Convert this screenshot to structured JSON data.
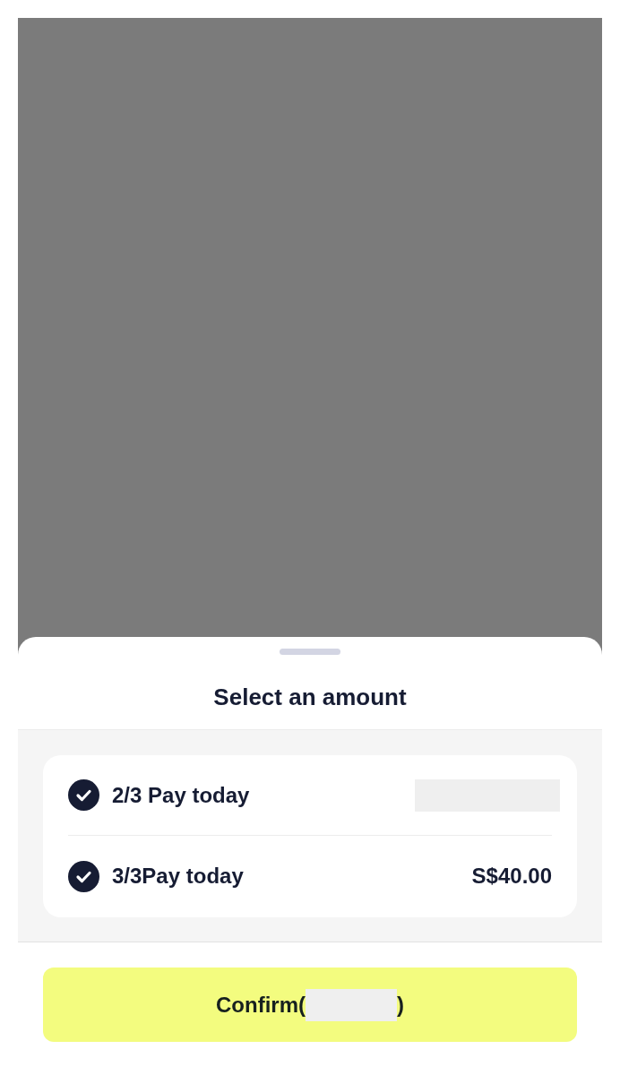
{
  "sheet": {
    "title": "Select an amount"
  },
  "options": [
    {
      "label": "2/3 Pay today",
      "checked": true,
      "redacted": true
    },
    {
      "label": "3/3Pay today",
      "checked": true,
      "redacted": false,
      "amount": "S$40.00"
    }
  ],
  "confirm_button": {
    "label_start": "Confirm(",
    "label_end": ")",
    "redacted": true
  }
}
